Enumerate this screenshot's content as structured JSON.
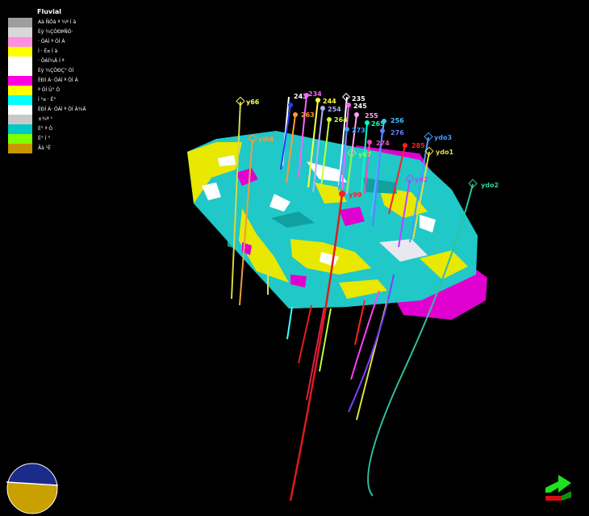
{
  "legend": {
    "title": "Fluvial",
    "items": [
      {
        "label": "Aà ÑÒà ª ¾ª Í à",
        "color": "#9e9e9e"
      },
      {
        "label": "Èý ¾ÇÒÐÞÑÒ·",
        "color": "#d8d8d8"
      },
      {
        "label": "· ÒÁÍ ª ÒÍ À",
        "color": "#ff8fe0"
      },
      {
        "label": "Í · É¤ Í à",
        "color": "#ffff00"
      },
      {
        "label": "· ÒÁÍ¾Ä Í ª",
        "color": "#ffffff"
      },
      {
        "label": "Èý ¾ÇÒÐÇ° ÒÍ",
        "color": "#ffffff"
      },
      {
        "label": "ÈÐÍ À· ÒÁÍ ª ÒÍ À",
        "color": "#ff00e0"
      },
      {
        "label": "ª ÒÍ Ù° Ò",
        "color": "#ffff00"
      },
      {
        "label": "Í ¹¤ · É°",
        "color": "#00ffff"
      },
      {
        "label": "ÈÐÍ À· ÒÁÍ ª ÒÍ À¾Ä",
        "color": "#ffffff"
      },
      {
        "label": "±¾ª ¹",
        "color": "#c8c8c8"
      },
      {
        "label": "É° ª Ò",
        "color": "#00c8c8"
      },
      {
        "label": "É° Í °",
        "color": "#80ff00"
      },
      {
        "label": "Ãà ¹Ê",
        "color": "#c89600"
      }
    ]
  },
  "wells": [
    {
      "name": "y66",
      "kind": "head",
      "color": "#ffff55"
    },
    {
      "name": "ydi4",
      "kind": "head",
      "color": "#ff9a30"
    },
    {
      "name": "243",
      "kind": "dot",
      "color": "#2040ff"
    },
    {
      "name": "234",
      "kind": "dot",
      "color": "#ff60ff"
    },
    {
      "name": "244",
      "kind": "dot",
      "color": "#ffff40"
    },
    {
      "name": "254",
      "kind": "dot",
      "color": "#b0b0ff"
    },
    {
      "name": "263",
      "kind": "dot",
      "color": "#ff9a30"
    },
    {
      "name": "264",
      "kind": "dot",
      "color": "#c0ff40"
    },
    {
      "name": "235",
      "kind": "dot",
      "color": "#ffffff"
    },
    {
      "name": "245",
      "kind": "dot",
      "color": "#ff60ff"
    },
    {
      "name": "255",
      "kind": "dot",
      "color": "#ffa0ff"
    },
    {
      "name": "265",
      "kind": "dot",
      "color": "#00ffc0"
    },
    {
      "name": "273",
      "kind": "dot",
      "color": "#40a0ff"
    },
    {
      "name": "y67",
      "kind": "head",
      "color": "#80ff40"
    },
    {
      "name": "274",
      "kind": "dot",
      "color": "#ff40c0"
    },
    {
      "name": "256",
      "kind": "dot",
      "color": "#40c0ff"
    },
    {
      "name": "276",
      "kind": "dot",
      "color": "#6080ff"
    },
    {
      "name": "285",
      "kind": "dot",
      "color": "#ff2020"
    },
    {
      "name": "y99",
      "kind": "dot",
      "color": "#ff2020"
    },
    {
      "name": "yd2",
      "kind": "head",
      "color": "#c040ff"
    },
    {
      "name": "ydo3",
      "kind": "head",
      "color": "#40a0ff"
    },
    {
      "name": "ydo1",
      "kind": "head",
      "color": "#e0e040"
    },
    {
      "name": "ydo2",
      "kind": "head",
      "color": "#30d0a0"
    }
  ],
  "icons": {
    "orientation": "orientation-sphere-icon",
    "axis": "axis-triad-icon"
  }
}
